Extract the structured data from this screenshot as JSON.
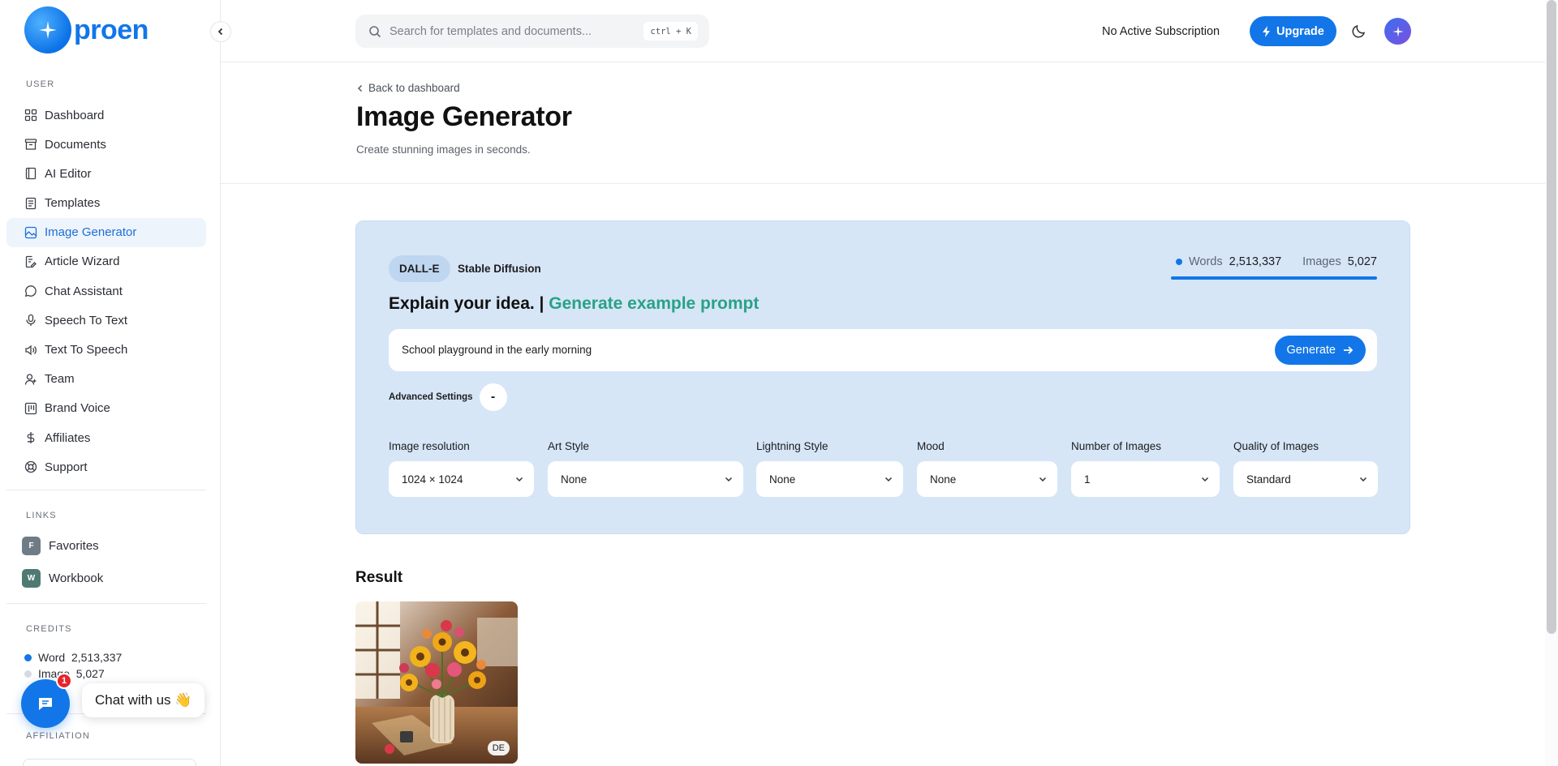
{
  "brand": {
    "name": "proen",
    "accent": "#1276e8"
  },
  "sidebar": {
    "user_label": "USER",
    "items": [
      {
        "label": "Dashboard",
        "icon": "grid-icon"
      },
      {
        "label": "Documents",
        "icon": "archive-icon"
      },
      {
        "label": "AI Editor",
        "icon": "notebook-icon"
      },
      {
        "label": "Templates",
        "icon": "document-icon"
      },
      {
        "label": "Image Generator",
        "icon": "image-icon",
        "active": true
      },
      {
        "label": "Article Wizard",
        "icon": "file-edit-icon"
      },
      {
        "label": "Chat Assistant",
        "icon": "chat-icon"
      },
      {
        "label": "Speech To Text",
        "icon": "microphone-icon"
      },
      {
        "label": "Text To Speech",
        "icon": "speaker-icon"
      },
      {
        "label": "Team",
        "icon": "user-plus-icon"
      },
      {
        "label": "Brand Voice",
        "icon": "board-icon"
      },
      {
        "label": "Affiliates",
        "icon": "dollar-icon"
      },
      {
        "label": "Support",
        "icon": "lifebuoy-icon"
      }
    ],
    "links_label": "LINKS",
    "links": [
      {
        "letter": "F",
        "label": "Favorites",
        "color": "#6f7c86"
      },
      {
        "letter": "W",
        "label": "Workbook",
        "color": "#4f7a74"
      }
    ],
    "credits_label": "CREDITS",
    "credits": [
      {
        "label": "Word",
        "value": "2,513,337",
        "color": "#1276e8"
      },
      {
        "label": "Image",
        "value": "5,027",
        "color": "#d6dbe2"
      }
    ],
    "affiliation_label": "AFFILIATION"
  },
  "chat_widget": {
    "label": "Chat with us 👋",
    "count": "1"
  },
  "topbar": {
    "search_placeholder": "Search for templates and documents...",
    "shortcut": "ctrl + K",
    "subscription": "No Active Subscription",
    "upgrade": "Upgrade"
  },
  "header": {
    "back": "Back to dashboard",
    "title": "Image Generator",
    "subtitle": "Create stunning images in seconds."
  },
  "generator": {
    "tabs": [
      "DALL-E",
      "Stable Diffusion"
    ],
    "stats": {
      "words_label": "Words",
      "words_value": "2,513,337",
      "images_label": "Images",
      "images_value": "5,027"
    },
    "heading": "Explain your idea. |",
    "example_link": "Generate example prompt",
    "prompt_value": "School playground in the early morning",
    "generate": "Generate",
    "advanced_label": "Advanced Settings",
    "advanced_toggle": "-",
    "fields": [
      {
        "label": "Image resolution",
        "value": "1024 × 1024"
      },
      {
        "label": "Art Style",
        "value": "None"
      },
      {
        "label": "Lightning Style",
        "value": "None"
      },
      {
        "label": "Mood",
        "value": "None"
      },
      {
        "label": "Number of Images",
        "value": "1"
      },
      {
        "label": "Quality of Images",
        "value": "Standard"
      }
    ]
  },
  "result": {
    "title": "Result",
    "badge": "DE"
  }
}
